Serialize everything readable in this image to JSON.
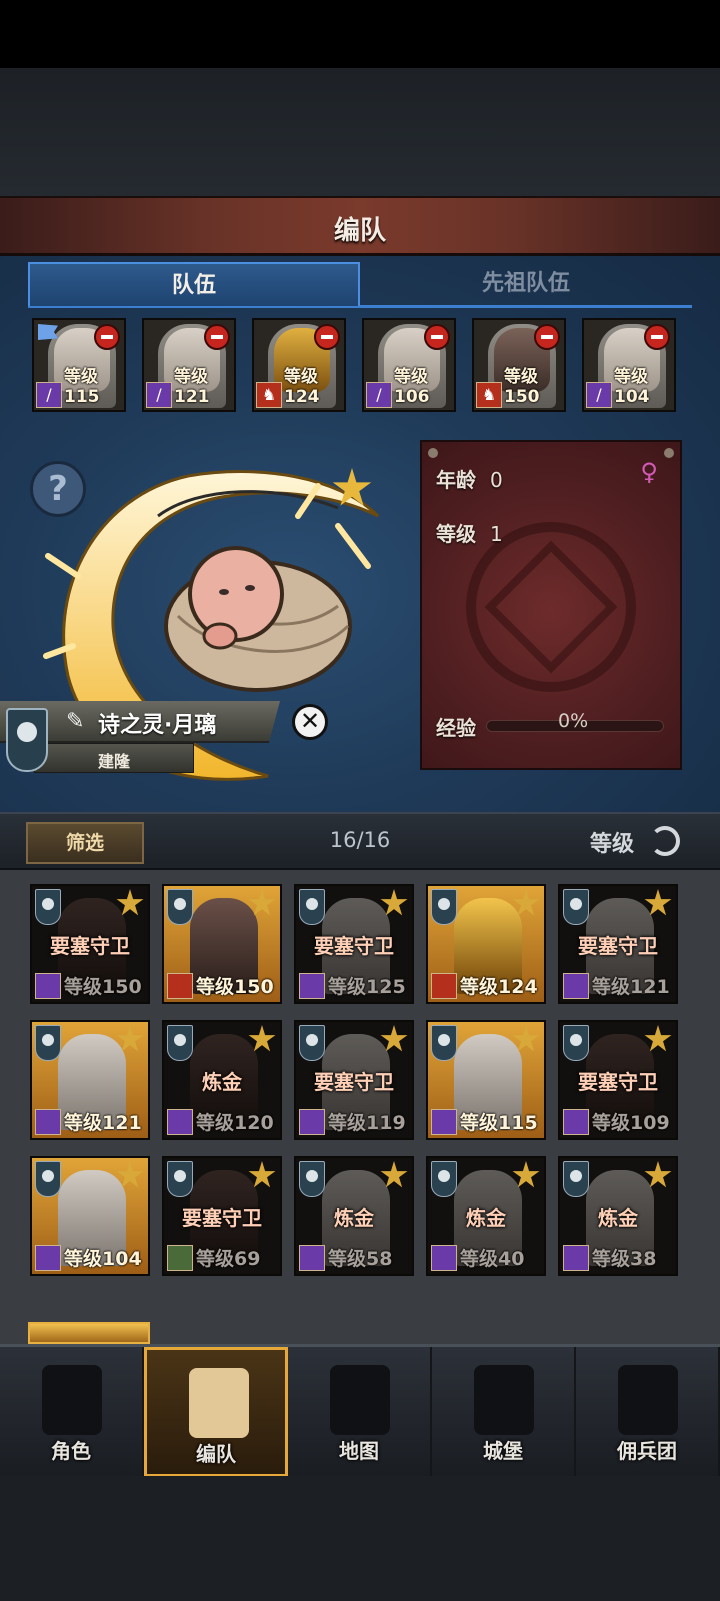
{
  "title": "编队",
  "tabs": {
    "team": "队伍",
    "ancestor": "先祖队伍"
  },
  "team_members": [
    {
      "level": "等级115",
      "class_icon": "staff-icon",
      "tone": "light",
      "flag": true
    },
    {
      "level": "等级121",
      "class_icon": "staff-icon",
      "tone": "light",
      "flag": false
    },
    {
      "level": "等级124",
      "class_icon": "horse-icon",
      "tone": "gold",
      "flag": false
    },
    {
      "level": "等级106",
      "class_icon": "staff-icon",
      "tone": "light",
      "flag": false
    },
    {
      "level": "等级150",
      "class_icon": "horse-icon",
      "tone": "dark",
      "flag": false
    },
    {
      "level": "等级104",
      "class_icon": "staff-icon",
      "tone": "light",
      "flag": false
    }
  ],
  "character": {
    "name": "诗之灵·月璃",
    "house": "建隆",
    "age_label": "年龄",
    "age": "0",
    "level_label": "等级",
    "level": "1",
    "exp_label": "经验",
    "exp_pct": "0%",
    "gender_icon": "female-icon"
  },
  "filter": {
    "button": "筛选",
    "count": "16/16",
    "sort": "等级"
  },
  "roster": [
    {
      "job": "要塞守卫",
      "level": "等级150",
      "active": false,
      "tone": "dark",
      "cls": "purple"
    },
    {
      "job": "",
      "level": "等级150",
      "active": true,
      "tone": "dark",
      "cls": "red"
    },
    {
      "job": "要塞守卫",
      "level": "等级125",
      "active": false,
      "tone": "light",
      "cls": "purple"
    },
    {
      "job": "",
      "level": "等级124",
      "active": true,
      "tone": "gold",
      "cls": "red"
    },
    {
      "job": "要塞守卫",
      "level": "等级121",
      "active": false,
      "tone": "light",
      "cls": "purple"
    },
    {
      "job": "",
      "level": "等级121",
      "active": true,
      "tone": "light",
      "cls": "purple"
    },
    {
      "job": "炼金",
      "level": "等级120",
      "active": false,
      "tone": "dark",
      "cls": "purple"
    },
    {
      "job": "要塞守卫",
      "level": "等级119",
      "active": false,
      "tone": "light",
      "cls": "purple"
    },
    {
      "job": "",
      "level": "等级115",
      "active": true,
      "tone": "light",
      "cls": "purple"
    },
    {
      "job": "要塞守卫",
      "level": "等级109",
      "active": false,
      "tone": "dark",
      "cls": "purple"
    },
    {
      "job": "",
      "level": "等级104",
      "active": true,
      "tone": "light",
      "cls": "purple"
    },
    {
      "job": "要塞守卫",
      "level": "等级69",
      "active": false,
      "tone": "dark",
      "cls": "green"
    },
    {
      "job": "炼金",
      "level": "等级58",
      "active": false,
      "tone": "light",
      "cls": "purple"
    },
    {
      "job": "炼金",
      "level": "等级40",
      "active": false,
      "tone": "light",
      "cls": "purple"
    },
    {
      "job": "炼金",
      "level": "等级38",
      "active": false,
      "tone": "light",
      "cls": "purple"
    }
  ],
  "nav": [
    {
      "label": "角色",
      "icon": "knight-icon",
      "active": false
    },
    {
      "label": "编队",
      "icon": "helmet-icon",
      "active": true
    },
    {
      "label": "地图",
      "icon": "compass-icon",
      "active": false
    },
    {
      "label": "城堡",
      "icon": "castle-icon",
      "active": false
    },
    {
      "label": "佣兵团",
      "icon": "mercenary-icon",
      "active": false
    }
  ]
}
